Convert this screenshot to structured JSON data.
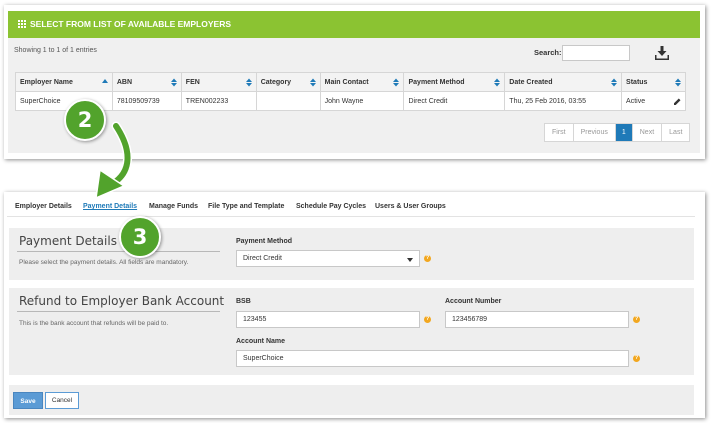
{
  "employers_panel": {
    "header": "SELECT FROM LIST OF AVAILABLE EMPLOYERS",
    "showing": "Showing 1 to 1 of 1 entries",
    "search_label": "Search:",
    "search_value": "",
    "columns": [
      "Employer Name",
      "ABN",
      "FEN",
      "Category",
      "Main Contact",
      "Payment Method",
      "Date Created",
      "Status"
    ],
    "rows": [
      {
        "employer_name": "SuperChoice",
        "abn": "78109509739",
        "fen": "TREN002233",
        "category": "",
        "main_contact": "John Wayne",
        "payment_method": "Direct Credit",
        "date_created": "Thu, 25 Feb 2016, 03:55",
        "status": "Active"
      }
    ],
    "pagination": {
      "first": "First",
      "previous": "Previous",
      "current": "1",
      "next": "Next",
      "last": "Last"
    }
  },
  "callouts": {
    "step2": "2",
    "step3": "3"
  },
  "tabs": [
    "Employer Details",
    "Payment Details",
    "Manage Funds",
    "File Type and Template",
    "Schedule Pay Cycles",
    "Users & User Groups"
  ],
  "active_tab": "Payment Details",
  "payment_details": {
    "title": "Payment Details",
    "description": "Please select the payment details. All fields are mandatory.",
    "payment_method_label": "Payment Method",
    "payment_method_value": "Direct Credit"
  },
  "refund_account": {
    "title": "Refund to Employer Bank Account",
    "description": "This is the bank account that refunds will be paid to.",
    "bsb_label": "BSB",
    "bsb_value": "123455",
    "account_number_label": "Account Number",
    "account_number_value": "123456789",
    "account_name_label": "Account Name",
    "account_name_value": "SuperChoice"
  },
  "actions": {
    "save": "Save",
    "cancel": "Cancel"
  },
  "colors": {
    "header_green": "#8bc332",
    "callout_green": "#52a32c",
    "active_blue": "#1f7ab8",
    "help_orange": "#f2a71f"
  }
}
